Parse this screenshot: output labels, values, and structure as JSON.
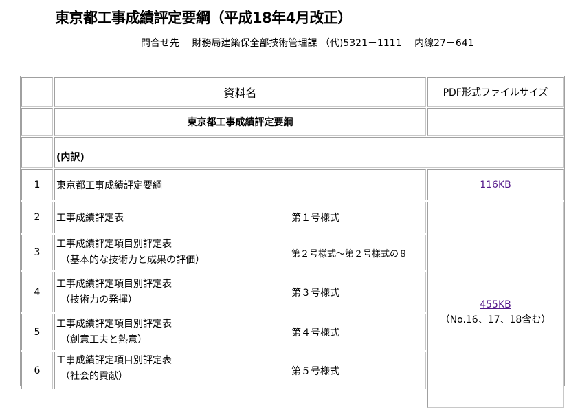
{
  "title": "東京都工事成績評定要綱（平成18年4月改正）",
  "contact": "問合せ先　 財務局建築保全部技術管理課 （代)5321－1111　 内線27－641",
  "table": {
    "headers": {
      "name": "資料名",
      "size": "PDF形式ファイルサイズ"
    },
    "main_title": "東京都工事成績評定要綱",
    "breakdown": "(内訳)",
    "rows": [
      {
        "no": "1",
        "name": "東京都工事成績評定要綱",
        "size": "116KB"
      },
      {
        "no": "2",
        "name": "工事成績評定表",
        "form": "第１号様式"
      },
      {
        "no": "3",
        "name": "工事成績評定項目別評定表",
        "sub": "（基本的な技術力と成果の評価）",
        "form": "第２号様式～第２号様式の８"
      },
      {
        "no": "4",
        "name": "工事成績評定項目別評定表",
        "sub": "（技術力の発揮）",
        "form": "第３号様式"
      },
      {
        "no": "5",
        "name": "工事成績評定項目別評定表",
        "sub": "（創意工夫と熱意）",
        "form": "第４号様式"
      },
      {
        "no": "6",
        "name": "工事成績評定項目別評定表",
        "sub": "（社会的貢献）",
        "form": "第５号様式"
      }
    ],
    "group_size": {
      "link": "455KB",
      "note": "（No.16、17、18含む）"
    }
  }
}
